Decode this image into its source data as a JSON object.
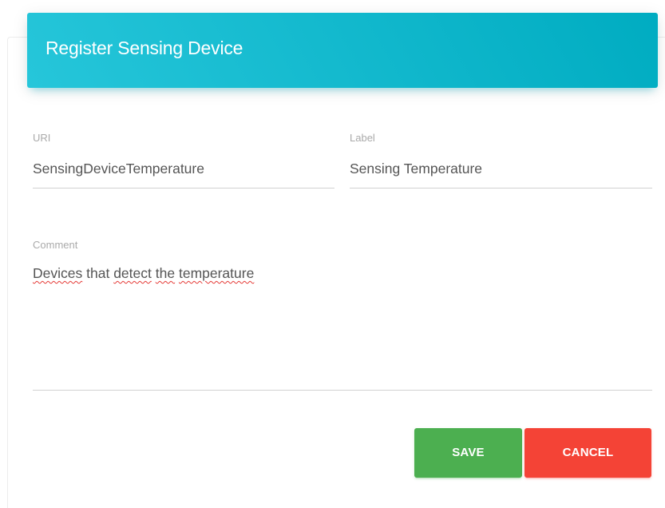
{
  "dialog": {
    "title": "Register Sensing Device"
  },
  "form": {
    "uri": {
      "label": "URI",
      "value": "SensingDeviceTemperature"
    },
    "label": {
      "label": "Label",
      "value": "Sensing Temperature"
    },
    "comment": {
      "label": "Comment",
      "words": [
        "Devices",
        "that",
        "detect",
        "the",
        "temperature"
      ]
    }
  },
  "actions": {
    "save_label": "SAVE",
    "cancel_label": "CANCEL"
  },
  "colors": {
    "header_start": "#26c6da",
    "header_end": "#00acc1",
    "save": "#4caf50",
    "cancel": "#f44336",
    "spellcheck_underline": "#e53935"
  }
}
